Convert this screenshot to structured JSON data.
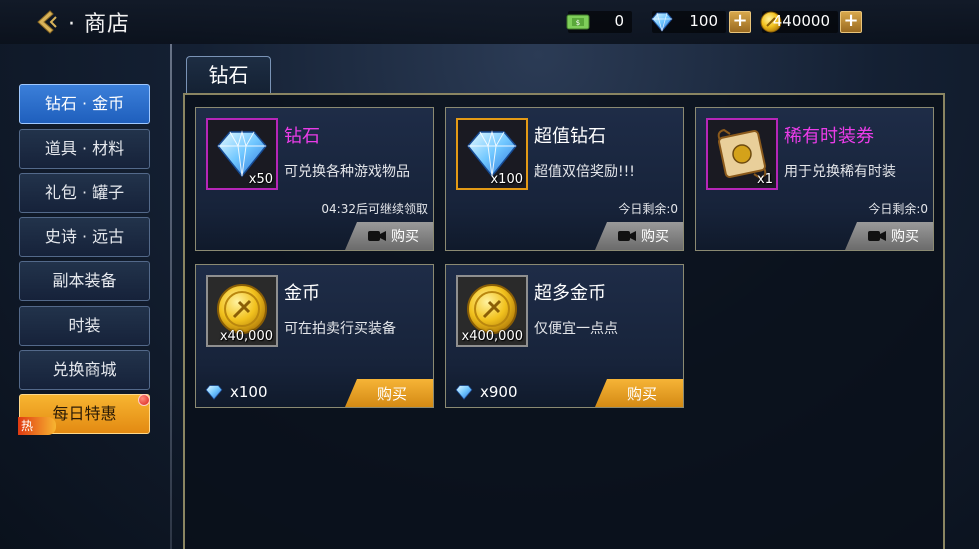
{
  "header": {
    "title": "· 商店",
    "cash": "0",
    "diamonds": "100",
    "gold": "440000"
  },
  "sidebar": {
    "items": [
      {
        "label": "钻石 · 金币"
      },
      {
        "label": "道具 · 材料"
      },
      {
        "label": "礼包 · 罐子"
      },
      {
        "label": "史诗 · 远古"
      },
      {
        "label": "副本装备"
      },
      {
        "label": "时装"
      },
      {
        "label": "兑换商城"
      },
      {
        "label": "每日特惠",
        "badge": "热"
      }
    ]
  },
  "main": {
    "tab": "钻石",
    "cards": [
      {
        "name": "钻石",
        "desc": "可兑换各种游戏物品",
        "qty": "x50",
        "note": "04:32后可继续领取",
        "button": "购买",
        "icon": "diamond-icon"
      },
      {
        "name": "超值钻石",
        "desc": "超值双倍奖励!!!",
        "qty": "x100",
        "note": "今日剩余:0",
        "button": "购买",
        "icon": "diamond-icon"
      },
      {
        "name": "稀有时装券",
        "desc": "用于兑换稀有时装",
        "qty": "x1",
        "note": "今日剩余:0",
        "button": "购买",
        "icon": "scroll-icon"
      },
      {
        "name": "金币",
        "desc": "可在拍卖行买装备",
        "qty": "x40,000",
        "price": "x100",
        "button": "购买",
        "icon": "gold-coin-icon"
      },
      {
        "name": "超多金币",
        "desc": "仅便宜一点点",
        "qty": "x400,000",
        "price": "x900",
        "button": "购买",
        "icon": "gold-coin-icon"
      }
    ]
  },
  "colors": {
    "rare_purple": "#ea3ce8",
    "gold_button": "#f6b437",
    "active_tab_blue": "#2f72d0"
  }
}
